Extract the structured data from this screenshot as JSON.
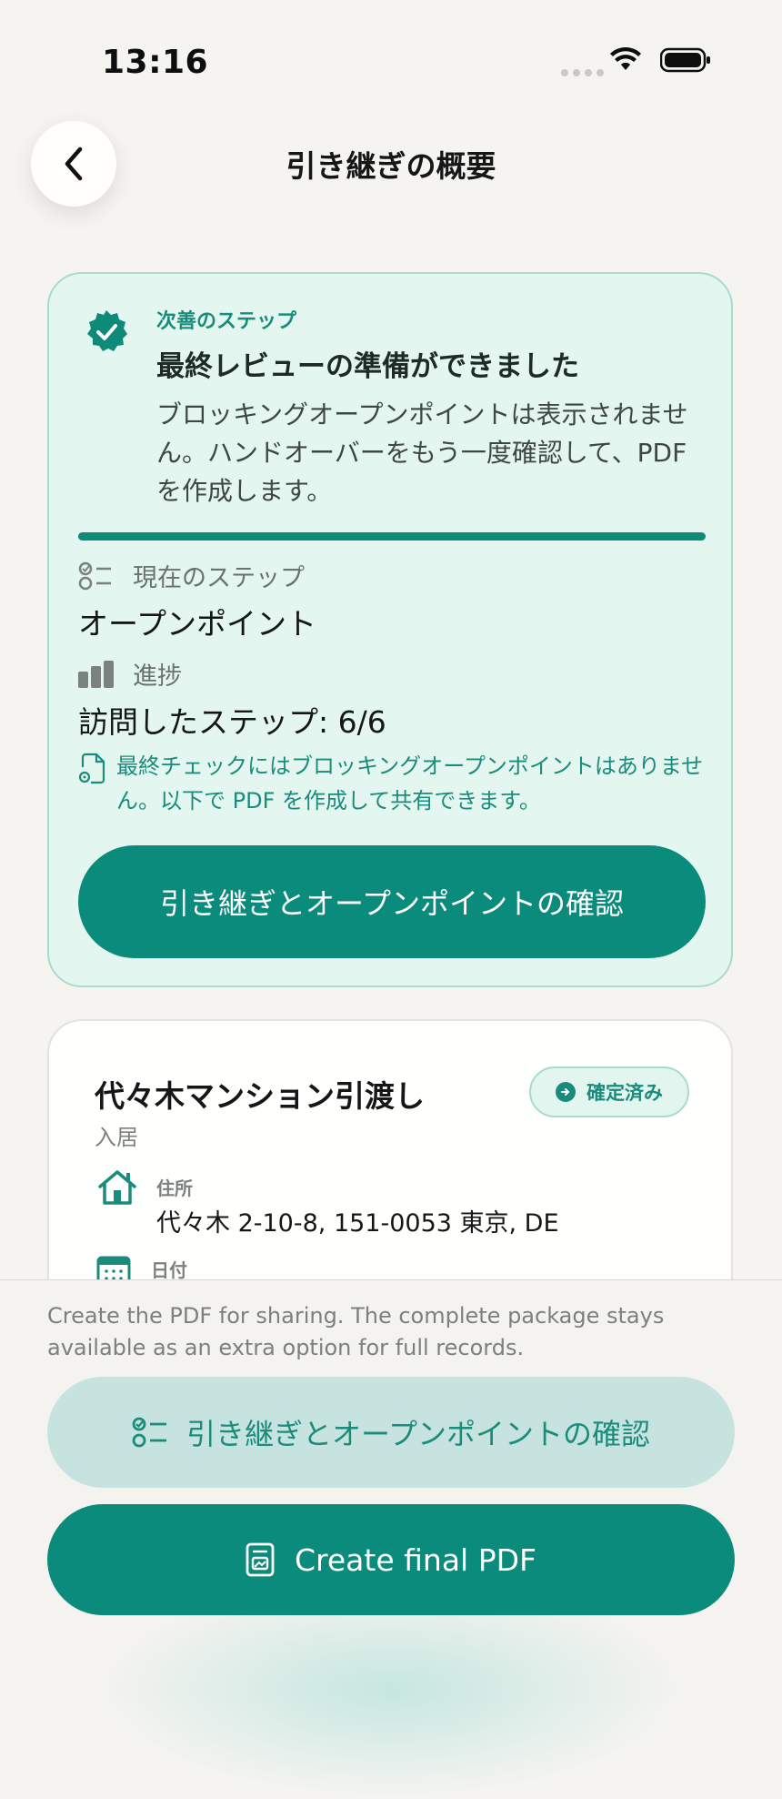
{
  "status_bar": {
    "time": "13:16"
  },
  "header": {
    "back_icon": "chevron-left-icon",
    "title": "引き継ぎの概要"
  },
  "next_step": {
    "eyebrow": "次善のステップ",
    "title": "最終レビューの準備ができました",
    "description": "ブロッキングオープンポイントは表示されません。ハンドオーバーをもう一度確認して、PDF を作成します。",
    "progress_fraction": 1.0,
    "current_step_label": "現在のステップ",
    "current_step_value": "オープンポイント",
    "progress_label": "進捗",
    "progress_value": "訪問したステップ: 6/6",
    "note": "最終チェックにはブロッキングオープンポイントはありません。以下で PDF を作成して共有できます。",
    "button_label": "引き継ぎとオープンポイントの確認"
  },
  "property": {
    "title": "代々木マンション引渡し",
    "subtitle": "入居",
    "status": "確定済み",
    "address_label": "住所",
    "address_value": "代々木 2-10-8, 151-0053 東京, DE",
    "date_label": "日付"
  },
  "bottom": {
    "note": "Create the PDF for sharing. The complete package stays available as an extra option for full records.",
    "review_button": "引き継ぎとオープンポイントの確認",
    "pdf_button": "Create final PDF"
  },
  "colors": {
    "accent": "#0a8b7b",
    "card_bg": "#e3f6ef",
    "page_bg": "#f5f4f1"
  }
}
